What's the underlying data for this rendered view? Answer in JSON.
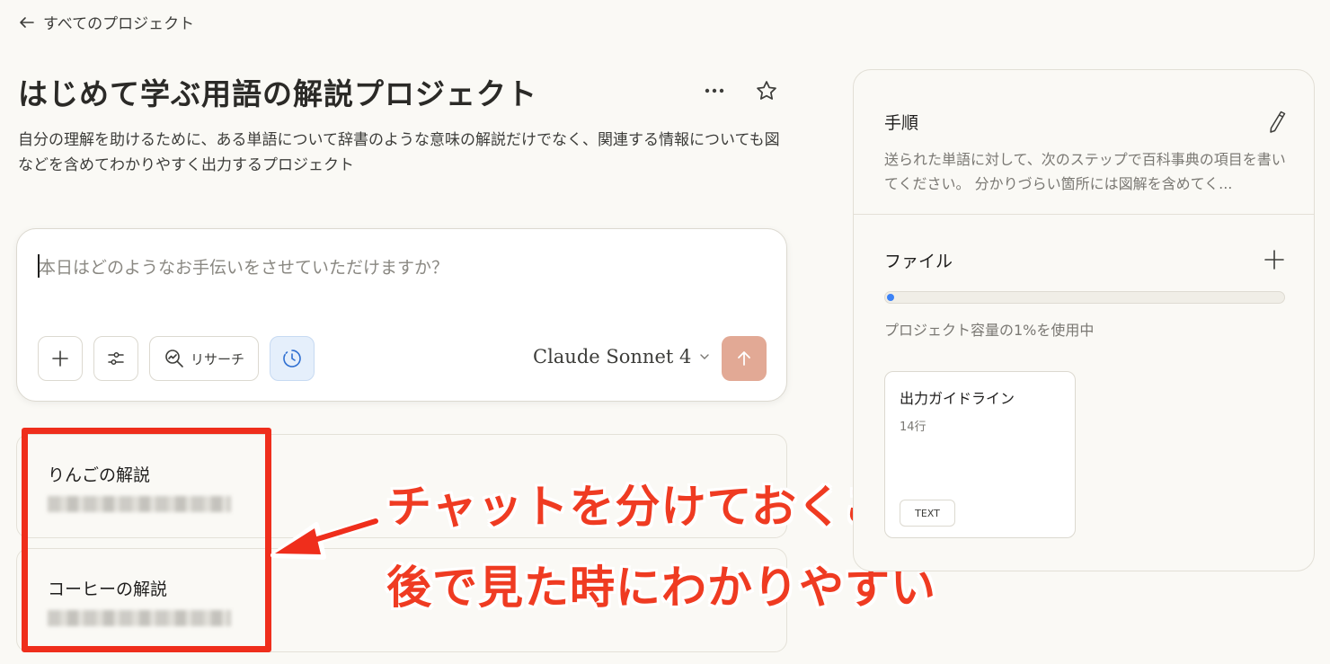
{
  "nav": {
    "back_label": "すべてのプロジェクト"
  },
  "project": {
    "title": "はじめて学ぶ用語の解説プロジェクト",
    "description": "自分の理解を助けるために、ある単語について辞書のような意味の解説だけでなく、関連する情報についても図などを含めてわかりやすく出力するプロジェクト"
  },
  "composer": {
    "placeholder": "本日はどのようなお手伝いをさせていただけますか？",
    "research_label": "リサーチ",
    "model_name": "Claude Sonnet 4"
  },
  "chats": [
    {
      "title": "りんごの解説"
    },
    {
      "title": "コーヒーの解説"
    }
  ],
  "annotation": {
    "line1": "チャットを分けておくことで",
    "line2": "後で見た時にわかりやすい",
    "color": "#ef2e1c"
  },
  "instructions": {
    "heading": "手順",
    "preview": "送られた単語に対して、次のステップで百科事典の項目を書いてください。 分かりづらい箇所には図解を含めてく..."
  },
  "files": {
    "heading": "ファイル",
    "usage_percent": 1,
    "usage_label": "プロジェクト容量の1%を使用中",
    "items": [
      {
        "name": "出力ガイドライン",
        "meta": "14行",
        "badge": "TEXT"
      }
    ]
  },
  "colors": {
    "accent_send": "#e2a995",
    "progress": "#3b82f6",
    "background": "#faf9f5"
  }
}
